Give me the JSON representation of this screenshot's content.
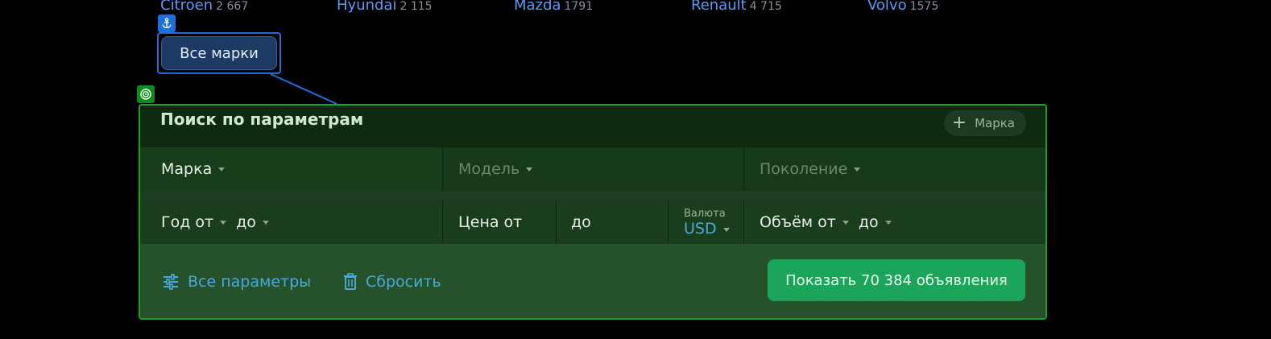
{
  "brands": [
    {
      "name": "Citroen",
      "count": "2 667"
    },
    {
      "name": "Hyundai",
      "count": "2 115"
    },
    {
      "name": "Mazda",
      "count": "1791"
    },
    {
      "name": "Renault",
      "count": "4 715"
    },
    {
      "name": "Volvo",
      "count": "1575"
    }
  ],
  "all_brands_button": "Все марки",
  "search": {
    "title": "Поиск по параметрам",
    "add_brand": "Марка",
    "brand_placeholder": "Марка",
    "model_placeholder": "Модель",
    "generation_placeholder": "Поколение",
    "year_from": "Год от",
    "year_to": "до",
    "price_from": "Цена от",
    "price_to": "до",
    "currency_label": "Валюта",
    "currency_value": "USD",
    "volume_from": "Объём от",
    "volume_to": "до",
    "all_params": "Все параметры",
    "reset": "Сбросить",
    "show_button": "Показать 70 384 объявления"
  },
  "icons": {
    "anchor_badge": "anchor-icon",
    "target_badge": "target-icon",
    "plus": "plus-icon",
    "params": "sliders-icon",
    "reset": "trash-icon"
  },
  "colors": {
    "accent_blue": "#1f6fd9",
    "accent_green": "#19a321",
    "link": "#4aa9d8",
    "cta": "#1aa55a"
  }
}
